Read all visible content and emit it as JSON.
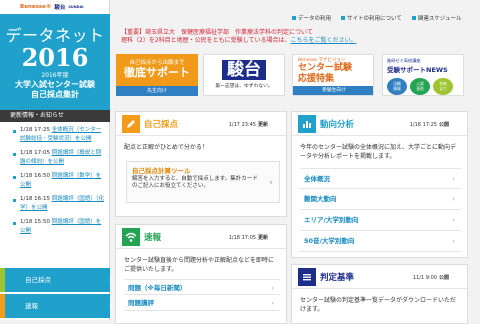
{
  "brand": {
    "benesse": "Benesse®",
    "sundai": "駿台",
    "sundai_sub": "SUNDAI"
  },
  "hero": {
    "title": "データネット",
    "year": "2016",
    "line1": "2016年度",
    "line2": "大学入試センター試験",
    "line3": "自己採点集計"
  },
  "news": {
    "heading": "更新情報・お知らせ",
    "items": [
      {
        "date": "1/18 17:25",
        "text": "全体概況（センター試験総括・受験状況）を公開"
      },
      {
        "date": "1/18 17:05",
        "text": "問題講評（概説と問題の傾向）を公開"
      },
      {
        "date": "1/18 16:50",
        "text": "問題講評（数学）を公開"
      },
      {
        "date": "1/18 16:15",
        "text": "問題講評（国語）（化学）を公開"
      },
      {
        "date": "1/18 15:50",
        "text": "問題講評（国語）を公開"
      }
    ]
  },
  "sidemenu": [
    "自己採点",
    "速報"
  ],
  "topnav": [
    "データの利用",
    "サイトの利用について",
    "partner_label_unused"
  ],
  "topnav_items": [
    "データの利用",
    "サイトの利用について",
    "関連スケジュール"
  ],
  "notice": {
    "line1": "【重要】埼玉県立大　保健医療福祉学部　作業療法学科の判定について",
    "line2": "理科（2）を2科目と地歴・公民をともに受験している場合は、",
    "link": "こちらをご覧ください。"
  },
  "banners": {
    "b1": {
      "r1": "自己採点から出願まで",
      "r2": "徹底サポート",
      "r3": "先生向け"
    },
    "b2": {
      "r1": "駿台",
      "r2": "第一志望は、ゆずれない。"
    },
    "b3": {
      "r0": "Benesse マナビジョン",
      "r1": "センター試験\n応援特集",
      "r2": "受験生向け"
    },
    "b4": {
      "r0": "進研ゼミ高校講座",
      "r1": "受験サポートNEWS",
      "c1": "出願\n情報",
      "c2": "入試\n直前",
      "c3": "合格\nまで"
    }
  },
  "cards": {
    "selfscore": {
      "title": "自己採点",
      "date": "1/17 23:45",
      "pub": "更新",
      "body": "配点と正解がひとめで分かる！",
      "sub_title": "自己採点計算ツール",
      "sub_desc": "解答を入力すると、自動で採点します。集計カードのご記入にお役立てください。"
    },
    "flash": {
      "title": "速報",
      "date": "1/18 17:05",
      "pub": "更新",
      "body": "センター試験直後から問題分析や正解配点などを即時にご提供いたします。",
      "links": [
        "問題（※毎日新聞）",
        "問題講評"
      ]
    },
    "trend": {
      "title": "動向分析",
      "date": "1/18 17:25",
      "pub": "公開",
      "body": "今年のセンター試験の全体概況に加え、大学ごとに動向データや分析レポートを掲載します。",
      "links": [
        "全体概況",
        "難関大動向",
        "エリア/大学別動向",
        "50音/大学別動向"
      ]
    },
    "judge": {
      "title": "判定基準",
      "date": "11/1 9:00",
      "pub": "公開",
      "body": "センター試験の判定基準一覧データがダウンロードいただけます。"
    }
  }
}
